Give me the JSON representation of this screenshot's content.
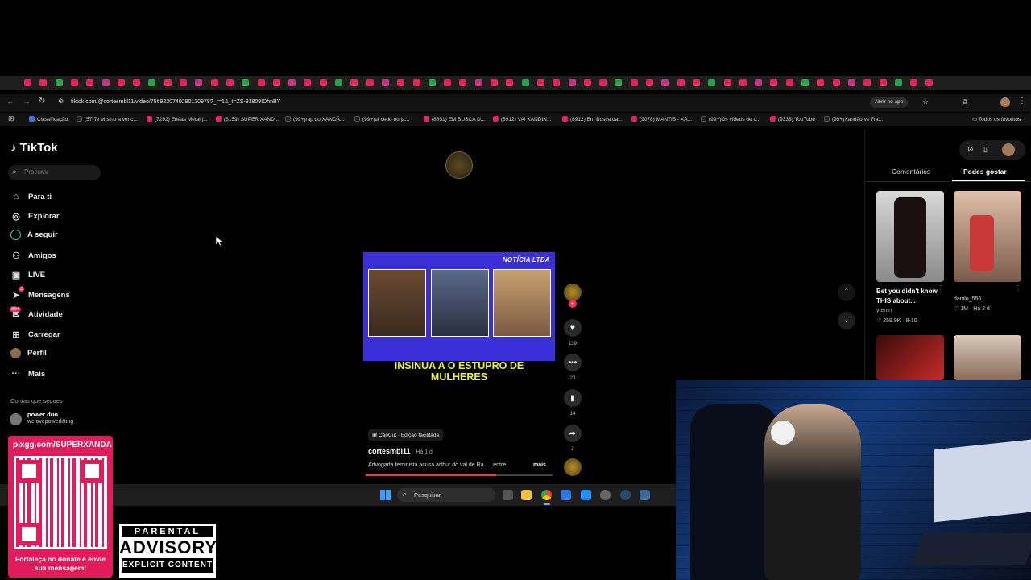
{
  "browser": {
    "url": "tiktok.com/@cortesmbl11/video/7569220740290120978?_r=1&_t=ZS-91809IDhnBY",
    "open_app": "Abrir no app",
    "bookmarks": [
      "Classificação",
      "(57)Te ensino a venc...",
      "(7292) Enéas Metal |...",
      "(8159) SUPER XAND...",
      "(99+)rap do XANDÃ...",
      "(99+)tá cedo ou já...",
      "(8851) EM BUSCA D...",
      "(8912) VAI XANDIN...",
      "(8912) Em Busca da...",
      "(9078) MANTIS - XA...",
      "(99+)Os vídeos de c...",
      "(9338) YouTube",
      "(99+)Xandão vs Fra..."
    ],
    "all_favorites": "Todos os favoritos"
  },
  "sidebar": {
    "logo": "TikTok",
    "search_placeholder": "Procurar",
    "items": [
      {
        "label": "Para ti",
        "icon": "home-icon"
      },
      {
        "label": "Explorar",
        "icon": "compass-icon"
      },
      {
        "label": "A seguir",
        "icon": "following-icon"
      },
      {
        "label": "Amigos",
        "icon": "friends-icon"
      },
      {
        "label": "LIVE",
        "icon": "live-icon"
      },
      {
        "label": "Mensagens",
        "icon": "messages-icon"
      },
      {
        "label": "Atividade",
        "icon": "activity-icon"
      },
      {
        "label": "Carregar",
        "icon": "upload-icon"
      },
      {
        "label": "Perfil",
        "icon": "profile-icon"
      },
      {
        "label": "Mais",
        "icon": "more-icon"
      }
    ],
    "messages_badge": "2",
    "activity_badge": "99+",
    "following_header": "Contas que segues",
    "following": [
      {
        "name": "power duo",
        "handle": "welovepowerlifting"
      }
    ]
  },
  "video": {
    "banner": "NOTÍCIA LTDA",
    "caption": "INSINUA A O ESTUPRO DE MULHERES",
    "capcut": "CapCut · Edição facilitada",
    "author": "cortesmbl11",
    "time": "Há 1 d",
    "description": "Advogada feminista acusa arthur do val de Ra..... entre",
    "more": "mais",
    "likes": "139",
    "comments": "20",
    "saves": "14",
    "shares": "2",
    "progress": 0.7
  },
  "right_panel": {
    "tabs": [
      "Comentários",
      "Podes gostar"
    ],
    "cards": [
      {
        "title": "Bet you didn't know THIS about...",
        "user": "ytemrr",
        "likes": "259.9K",
        "date": "8-10"
      },
      {
        "title": "",
        "user": "danilo_556",
        "likes": "1M",
        "date": "Há 2 d"
      }
    ]
  },
  "taskbar": {
    "search": "Pesquisar"
  },
  "overlay": {
    "pix_url": "pixgg.com/SUPERXANDÃ",
    "pix_text": "Fortaleça no donate e envie sua mensagem!",
    "advisory_top": "PARENTAL",
    "advisory_mid": "ADVISORY",
    "advisory_bot": "EXPLICIT CONTENT"
  },
  "colors": {
    "accent": "#fe2c55",
    "video_bg": "#3a2fd8",
    "caption": "#e6f53a"
  }
}
